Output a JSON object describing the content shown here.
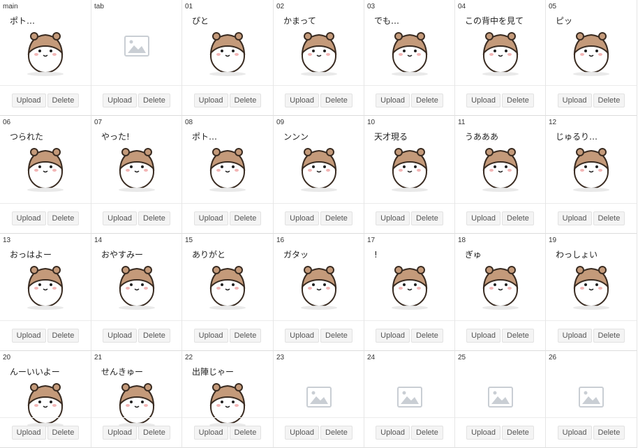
{
  "buttons": {
    "upload": "Upload",
    "delete": "Delete"
  },
  "cells": [
    {
      "label": "main",
      "image": "hamster"
    },
    {
      "label": "tab",
      "image": "empty"
    },
    {
      "label": "01",
      "image": "hamster"
    },
    {
      "label": "02",
      "image": "hamster"
    },
    {
      "label": "03",
      "image": "hamster"
    },
    {
      "label": "04",
      "image": "hamster"
    },
    {
      "label": "05",
      "image": "hamster"
    },
    {
      "label": "06",
      "image": "hamster"
    },
    {
      "label": "07",
      "image": "hamster"
    },
    {
      "label": "08",
      "image": "hamster"
    },
    {
      "label": "09",
      "image": "hamster"
    },
    {
      "label": "10",
      "image": "hamster"
    },
    {
      "label": "11",
      "image": "hamster"
    },
    {
      "label": "12",
      "image": "hamster"
    },
    {
      "label": "13",
      "image": "hamster"
    },
    {
      "label": "14",
      "image": "hamster"
    },
    {
      "label": "15",
      "image": "hamster"
    },
    {
      "label": "16",
      "image": "hamster"
    },
    {
      "label": "17",
      "image": "hamster"
    },
    {
      "label": "18",
      "image": "hamster"
    },
    {
      "label": "19",
      "image": "hamster"
    },
    {
      "label": "20",
      "image": "hamster"
    },
    {
      "label": "21",
      "image": "hamster"
    },
    {
      "label": "22",
      "image": "hamster"
    },
    {
      "label": "23",
      "image": "empty"
    },
    {
      "label": "24",
      "image": "empty"
    },
    {
      "label": "25",
      "image": "empty"
    },
    {
      "label": "26",
      "image": "empty"
    }
  ],
  "sticker_texts": {
    "main": "ポト…",
    "01": "ぴと",
    "02": "かまって",
    "03": "でも…",
    "04": "この背中を見て",
    "05": "ピッ",
    "06": "つられた",
    "07": "やった!",
    "08": "ポト…",
    "09": "ンンン",
    "10": "天才現る",
    "11": "うあああ",
    "12": "じゅるり…",
    "13": "おっはよー",
    "14": "おやすみー",
    "15": "ありがと",
    "16": "ガタッ",
    "17": "!",
    "18": "ぎゅ",
    "19": "わっしょい",
    "20": "んーいいよー",
    "21": "せんきゅー",
    "22": "出陣じゃー"
  }
}
